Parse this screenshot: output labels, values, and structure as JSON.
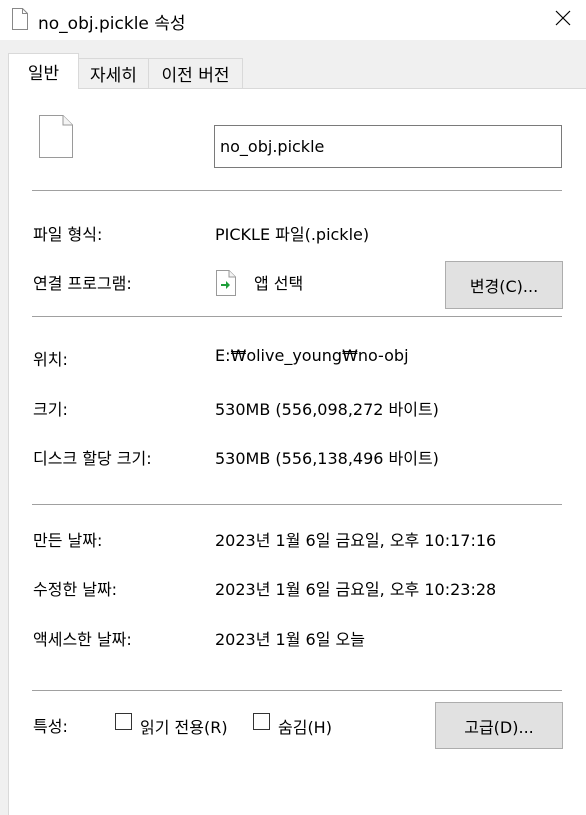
{
  "window": {
    "title": "no_obj.pickle 속성",
    "icons": {
      "file": "file-icon",
      "close": "close-icon"
    }
  },
  "tabs": [
    {
      "label": "일반",
      "active": true
    },
    {
      "label": "자세히",
      "active": false
    },
    {
      "label": "이전 버전",
      "active": false
    }
  ],
  "general": {
    "file_name": "no_obj.pickle",
    "file_type_label": "파일 형식:",
    "file_type_value": "PICKLE 파일(.pickle)",
    "opens_with_label": "연결 프로그램:",
    "opens_with_value": "앱 선택",
    "change_button": "변경(C)...",
    "location_label": "위치:",
    "location_value": "E:₩olive_young₩no-obj",
    "size_label": "크기:",
    "size_value": "530MB (556,098,272 바이트)",
    "size_on_disk_label": "디스크 할당 크기:",
    "size_on_disk_value": "530MB (556,138,496 바이트)",
    "created_label": "만든 날짜:",
    "created_value": "2023년 1월 6일 금요일, 오후 10:17:16",
    "modified_label": "수정한 날짜:",
    "modified_value": "2023년 1월 6일 금요일, 오후 10:23:28",
    "accessed_label": "액세스한 날짜:",
    "accessed_value": "2023년 1월 6일 오늘",
    "attributes_label": "특성:",
    "readonly_label": "읽기 전용(R)",
    "readonly_checked": false,
    "hidden_label": "숨김(H)",
    "hidden_checked": false,
    "advanced_button": "고급(D)..."
  },
  "colors": {
    "accent_green": "#1e9e3a",
    "panel_bg": "#ffffff",
    "dialog_bg": "#f0f0f0"
  }
}
